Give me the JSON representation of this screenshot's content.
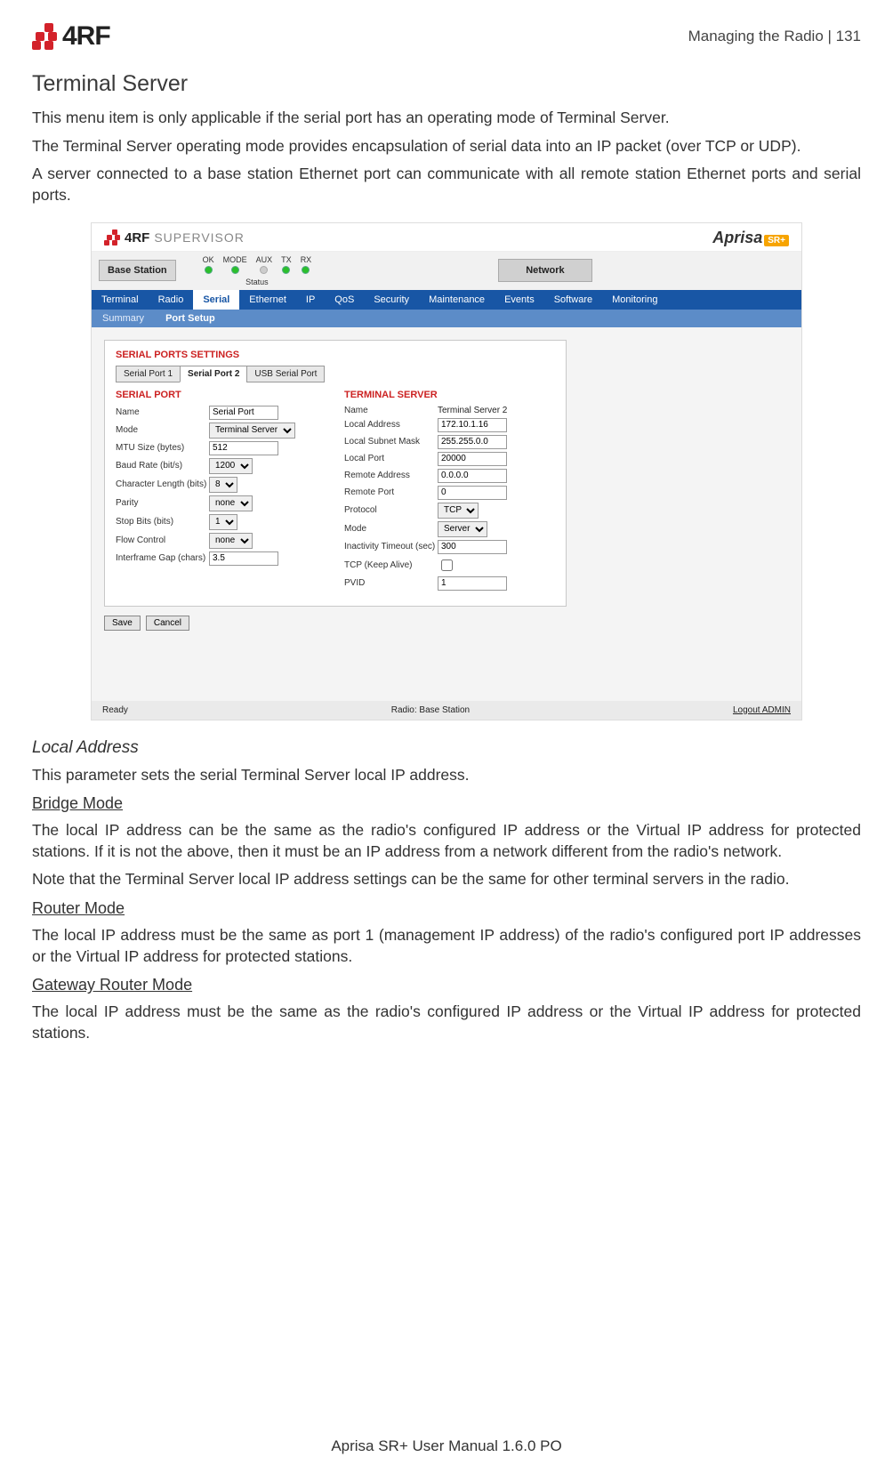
{
  "header": {
    "logo_text": "4RF",
    "right": "Managing the Radio  |  131"
  },
  "title": "Terminal Server",
  "paras": {
    "p1": "This menu item is only applicable if the serial port has an operating mode of Terminal Server.",
    "p2": "The Terminal Server operating mode provides encapsulation of serial data into an IP packet (over TCP or UDP).",
    "p3": "A server connected to a base station Ethernet port can communicate with all remote station Ethernet ports and serial ports."
  },
  "shot": {
    "brand_4rf": "4RF",
    "brand_sup": "SUPERVISOR",
    "brand_right": "Aprisa",
    "brand_sr": "SR+",
    "base_station": "Base Station",
    "leds": [
      "OK",
      "MODE",
      "AUX",
      "TX",
      "RX"
    ],
    "status_label": "Status",
    "network_btn": "Network",
    "nav_main": [
      "Terminal",
      "Radio",
      "Serial",
      "Ethernet",
      "IP",
      "QoS",
      "Security",
      "Maintenance",
      "Events",
      "Software",
      "Monitoring"
    ],
    "nav_main_active": 2,
    "nav_sub": [
      "Summary",
      "Port Setup"
    ],
    "nav_sub_active": 1,
    "settings_title": "SERIAL PORTS SETTINGS",
    "port_tabs": [
      "Serial Port 1",
      "Serial Port 2",
      "USB Serial Port"
    ],
    "port_tabs_active": 1,
    "left_title": "SERIAL PORT",
    "right_title": "TERMINAL SERVER",
    "left_fields": [
      {
        "label": "Name",
        "type": "text",
        "value": "Serial Port"
      },
      {
        "label": "Mode",
        "type": "select",
        "value": "Terminal Server"
      },
      {
        "label": "MTU Size (bytes)",
        "type": "text",
        "value": "512"
      },
      {
        "label": "Baud Rate (bit/s)",
        "type": "select",
        "value": "1200"
      },
      {
        "label": "Character Length (bits)",
        "type": "select",
        "value": "8"
      },
      {
        "label": "Parity",
        "type": "select",
        "value": "none"
      },
      {
        "label": "Stop Bits (bits)",
        "type": "select",
        "value": "1"
      },
      {
        "label": "Flow Control",
        "type": "select",
        "value": "none"
      },
      {
        "label": "Interframe Gap (chars)",
        "type": "text",
        "value": "3.5"
      }
    ],
    "right_fields": [
      {
        "label": "Name",
        "type": "ro",
        "value": "Terminal Server 2"
      },
      {
        "label": "Local Address",
        "type": "text",
        "value": "172.10.1.16"
      },
      {
        "label": "Local Subnet Mask",
        "type": "text",
        "value": "255.255.0.0"
      },
      {
        "label": "Local Port",
        "type": "text",
        "value": "20000"
      },
      {
        "label": "Remote Address",
        "type": "text",
        "value": "0.0.0.0"
      },
      {
        "label": "Remote Port",
        "type": "text",
        "value": "0"
      },
      {
        "label": "Protocol",
        "type": "select",
        "value": "TCP"
      },
      {
        "label": "Mode",
        "type": "select",
        "value": "Server"
      },
      {
        "label": "Inactivity Timeout (sec)",
        "type": "text",
        "value": "300"
      },
      {
        "label": "TCP (Keep Alive)",
        "type": "checkbox",
        "value": ""
      },
      {
        "label": "PVID",
        "type": "text",
        "value": "1"
      }
    ],
    "save_btn": "Save",
    "cancel_btn": "Cancel",
    "footer_left": "Ready",
    "footer_mid": "Radio: Base Station",
    "footer_right": "Logout ADMIN"
  },
  "after": {
    "h_local": "Local Address",
    "p_local": "This parameter sets the serial Terminal Server local IP address.",
    "h_bridge": "Bridge Mode",
    "p_bridge1": "The local IP address can be the same as the radio's configured IP address or the Virtual IP address for protected stations. If it is not the above, then it must be an IP address from a network different from the radio's network.",
    "p_bridge2": "Note that the Terminal Server local IP address settings can be the same for other terminal servers in the radio.",
    "h_router": "Router Mode",
    "p_router": "The local IP address must be the same as port 1 (management IP address) of the radio's configured port IP addresses or the Virtual IP address for protected stations.",
    "h_gateway": "Gateway Router Mode",
    "p_gateway": "The local IP address must be the same as the radio's configured IP address or the Virtual IP address for protected stations."
  },
  "footer": "Aprisa SR+ User Manual 1.6.0 PO"
}
